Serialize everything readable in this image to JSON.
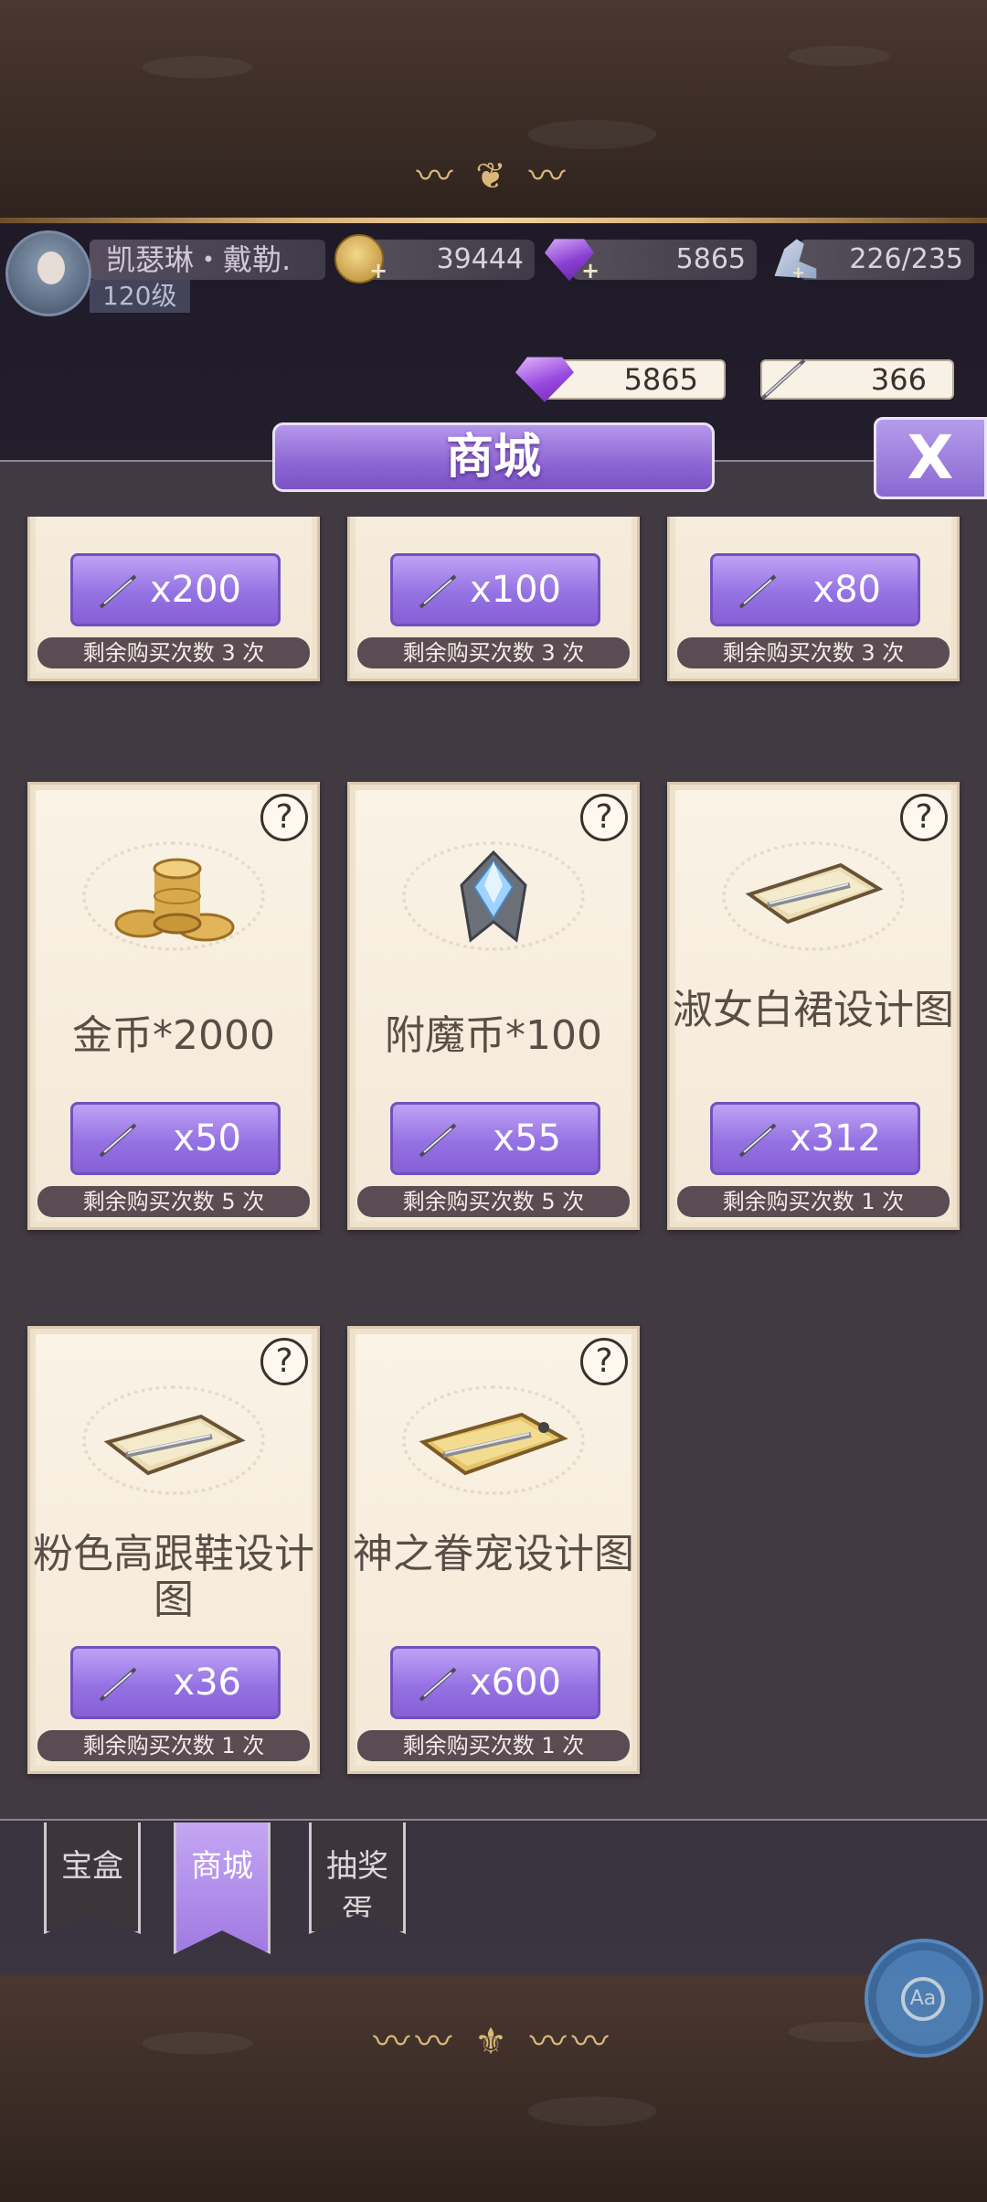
{
  "player": {
    "name": "凯瑟琳・戴勒.",
    "level": "120级"
  },
  "resources": {
    "gold": "39444",
    "gems": "5865",
    "stamina": "226/235"
  },
  "wallet": {
    "gems": "5865",
    "pens": "366"
  },
  "dialog": {
    "title": "商城",
    "close_label": "X"
  },
  "shop_items": [
    {
      "name": "",
      "price": "x200",
      "remain": "剩余购买次数 3 次"
    },
    {
      "name": "",
      "price": "x100",
      "remain": "剩余购买次数 3 次"
    },
    {
      "name": "",
      "price": "x80",
      "remain": "剩余购买次数 3 次"
    },
    {
      "name": "金币*2000",
      "price": "x50",
      "remain": "剩余购买次数 5 次",
      "icon": "gold-coins-icon"
    },
    {
      "name": "附魔币*100",
      "price": "x55",
      "remain": "剩余购买次数 5 次",
      "icon": "enchant-crystal-icon"
    },
    {
      "name": "淑女白裙设计图",
      "price": "x312",
      "remain": "剩余购买次数 1 次",
      "icon": "design-blueprint-icon"
    },
    {
      "name": "粉色高跟鞋设计图",
      "price": "x36",
      "remain": "剩余购买次数 1 次",
      "icon": "design-blueprint-icon"
    },
    {
      "name": "神之眷宠设计图",
      "price": "x600",
      "remain": "剩余购买次数 1 次",
      "icon": "design-blueprint-icon"
    }
  ],
  "help_label": "?",
  "tabs": [
    {
      "label": "宝盒"
    },
    {
      "label": "商城",
      "active": true
    },
    {
      "label": "抽奖蛋"
    }
  ],
  "accessibility_label": "Aa",
  "colors": {
    "accent": "#9572e3",
    "card_bg": "#faf3e6",
    "panel_bg": "#413a42"
  }
}
